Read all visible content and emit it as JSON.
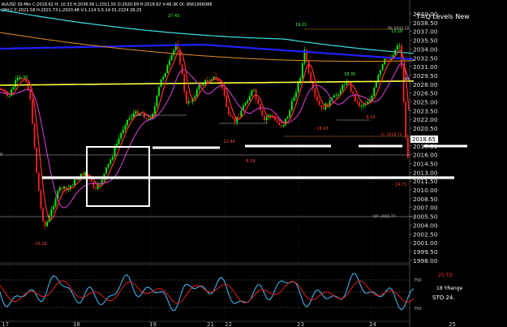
{
  "header": {
    "line1": "AUUSD 30-Min  C:2018.62  H: 10.33  H:2036.56  L:2011.55  O:2020.69  H:2018.62  V:46.3K  OI: 9561956086",
    "line2": "OHLC C:2021.58  H:2021.73  L:2020.48  V:1.114  S:5.14  01-2224  28:25",
    "chart_title": "T=Q Levels New"
  },
  "price_axis": {
    "ticks": [
      "2040.00",
      "2038.50",
      "2037.00",
      "2035.50",
      "2034.00",
      "2032.50",
      "2031.00",
      "2029.50",
      "2028.00",
      "2026.50",
      "2025.00",
      "2023.50",
      "2022.00",
      "2020.50",
      "2019.00",
      "2017.50",
      "2016.00",
      "2014.50",
      "2013.00",
      "2011.50",
      "2010.00",
      "2008.50",
      "2007.00",
      "2005.50",
      "2004.00",
      "2002.50",
      "2001.00",
      "1999.50",
      "1998.00"
    ],
    "current_price": "2018.65",
    "current_price_color": "#ffffff"
  },
  "annotations": {
    "a1": "11.30",
    "a2": "27.43",
    "a3": "19.21",
    "a4": "13.18",
    "a5": "18.35",
    "a6": "- 25.18",
    "a7": "- 6.29",
    "a8": "- 16.43",
    "a9": "- 9.14",
    "a10": "- 24.71",
    "a11": "- 22.44",
    "level_top": "IN: 2037.72",
    "level_mid": "IL: 2018.73",
    "level_low": "UP: 2005.77",
    "mm": "MM",
    "left_edge": "0"
  },
  "indicator": {
    "label1": "25 TD",
    "label1_color": "#ff3030",
    "label2": "18 YRange",
    "label3": "STO  24.",
    "tick1": "750",
    "tick2": "750"
  },
  "date_axis": {
    "labels": [
      "17",
      "18",
      "19",
      "21",
      "22",
      "23",
      "24",
      "25"
    ]
  },
  "colors": {
    "up_candle": "#00ff00",
    "down_candle": "#ff2020",
    "ma_blue": "#2020ff",
    "ma_cyan": "#40e0e0",
    "ma_yellow": "#ffff40",
    "ma_orange": "#e09020",
    "ma_magenta": "#e040e0",
    "ma_red": "#ff3030",
    "osc_cyan": "#40c0ff",
    "osc_red": "#e02020"
  }
}
